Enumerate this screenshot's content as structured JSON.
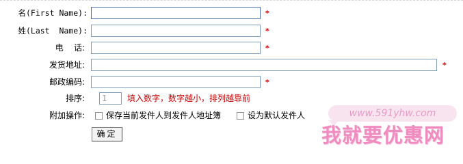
{
  "form": {
    "first_name": {
      "label": "名(First Name):",
      "value": ""
    },
    "last_name": {
      "label": "姓(Last  Name):",
      "value": ""
    },
    "phone": {
      "label": "电    话:",
      "value": ""
    },
    "address": {
      "label": "发货地址:",
      "value": ""
    },
    "postcode": {
      "label": "邮政编码:",
      "value": ""
    },
    "sort": {
      "label": "排序:",
      "value": "1",
      "hint": "填入数字，数字越小，排列越靠前"
    },
    "extra": {
      "label": "附加操作:",
      "option_save": "保存当前发件人到发件人地址簿",
      "option_default": "设为默认发件人",
      "option_save_checked": false,
      "option_default_checked": false
    },
    "required_mark": "*",
    "submit_label": "确定"
  },
  "watermark": {
    "url": "www.591yhw.com",
    "brand": "我就要优惠网"
  },
  "colors": {
    "required": "#cc0000",
    "input_border": "#7f9db9",
    "watermark": "#ef8cc0"
  }
}
